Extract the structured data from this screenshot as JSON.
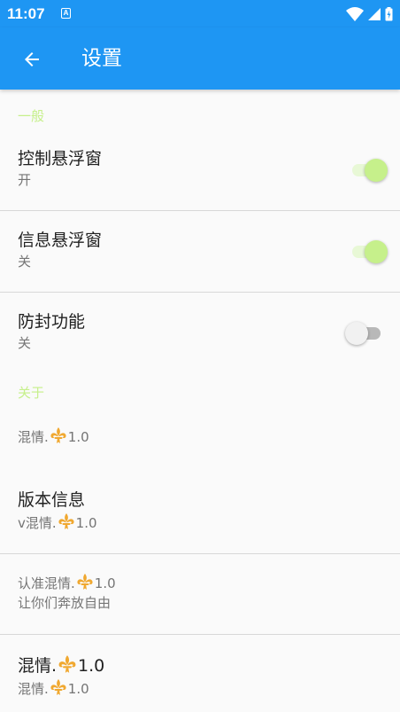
{
  "status_bar": {
    "time": "11:07",
    "notification_icon": "A",
    "icons": [
      "wifi-icon",
      "signal-icon",
      "battery-icon"
    ]
  },
  "app_bar": {
    "title": "设置",
    "back_icon": "arrow-left-icon",
    "color": "#1e96f3"
  },
  "accent_color": "#c6f08b",
  "sections": [
    {
      "category": "一般",
      "items": [
        {
          "title": "控制悬浮窗",
          "summary": "开",
          "switch_on": true
        },
        {
          "title": "信息悬浮窗",
          "summary": "关",
          "switch_on": true
        },
        {
          "title": "防封功能",
          "summary": "关",
          "switch_on": false
        }
      ]
    },
    {
      "category": "关于",
      "items": [
        {
          "summary_prefix": "混情.",
          "summary_suffix": "1.0"
        },
        {
          "title": "版本信息",
          "summary_prefix": "v混情.",
          "summary_suffix": "1.0"
        },
        {
          "summary_prefix": "认准混情.",
          "summary_suffix": "1.0",
          "summary_line2": "让你们奔放自由"
        },
        {
          "title_prefix": "混情.",
          "title_suffix": "1.0",
          "summary_prefix": "混情.",
          "summary_suffix": "1.0"
        }
      ]
    }
  ]
}
